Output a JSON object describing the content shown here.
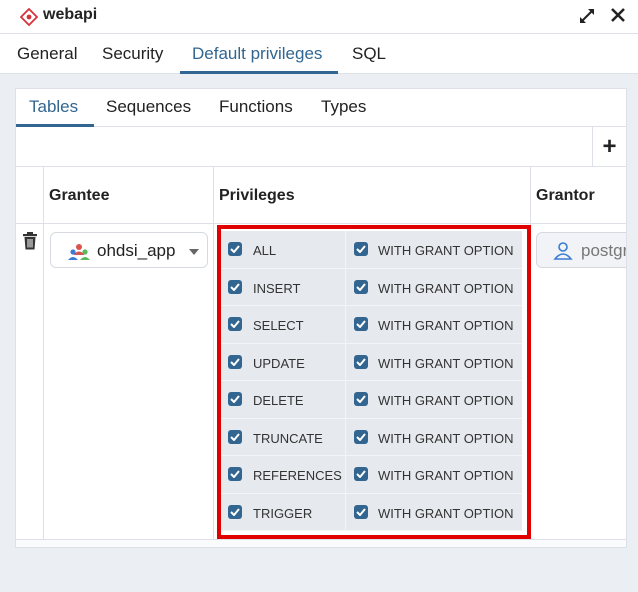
{
  "window": {
    "title": "webapi",
    "accent_color": "#326690",
    "highlight_color": "#e00000"
  },
  "main_tabs": [
    {
      "label": "General",
      "active": false
    },
    {
      "label": "Security",
      "active": false
    },
    {
      "label": "Default privileges",
      "active": true
    },
    {
      "label": "SQL",
      "active": false
    }
  ],
  "sub_tabs": [
    {
      "label": "Tables",
      "active": true
    },
    {
      "label": "Sequences",
      "active": false
    },
    {
      "label": "Functions",
      "active": false
    },
    {
      "label": "Types",
      "active": false
    }
  ],
  "toolbar": {
    "add_label": "+"
  },
  "grid": {
    "columns": {
      "grantee": "Grantee",
      "privileges": "Privileges",
      "grantor": "Grantor"
    },
    "row": {
      "grantee": "ohdsi_app",
      "grantor": "postgre",
      "privileges": [
        {
          "name": "ALL",
          "checked": true,
          "grant_option_label": "WITH GRANT OPTION",
          "grant_option": true
        },
        {
          "name": "INSERT",
          "checked": true,
          "grant_option_label": "WITH GRANT OPTION",
          "grant_option": true
        },
        {
          "name": "SELECT",
          "checked": true,
          "grant_option_label": "WITH GRANT OPTION",
          "grant_option": true
        },
        {
          "name": "UPDATE",
          "checked": true,
          "grant_option_label": "WITH GRANT OPTION",
          "grant_option": true
        },
        {
          "name": "DELETE",
          "checked": true,
          "grant_option_label": "WITH GRANT OPTION",
          "grant_option": true
        },
        {
          "name": "TRUNCATE",
          "checked": true,
          "grant_option_label": "WITH GRANT OPTION",
          "grant_option": true
        },
        {
          "name": "REFERENCES",
          "checked": true,
          "grant_option_label": "WITH GRANT OPTION",
          "grant_option": true
        },
        {
          "name": "TRIGGER",
          "checked": true,
          "grant_option_label": "WITH GRANT OPTION",
          "grant_option": true
        }
      ]
    }
  },
  "icons": {
    "app": "database-icon",
    "expand": "expand-icon",
    "close": "close-icon",
    "delete": "trash-icon",
    "grantee_role": "role-icon",
    "grantor_user": "user-icon",
    "dropdown": "chevron-down-icon",
    "checkbox": "check-icon"
  }
}
